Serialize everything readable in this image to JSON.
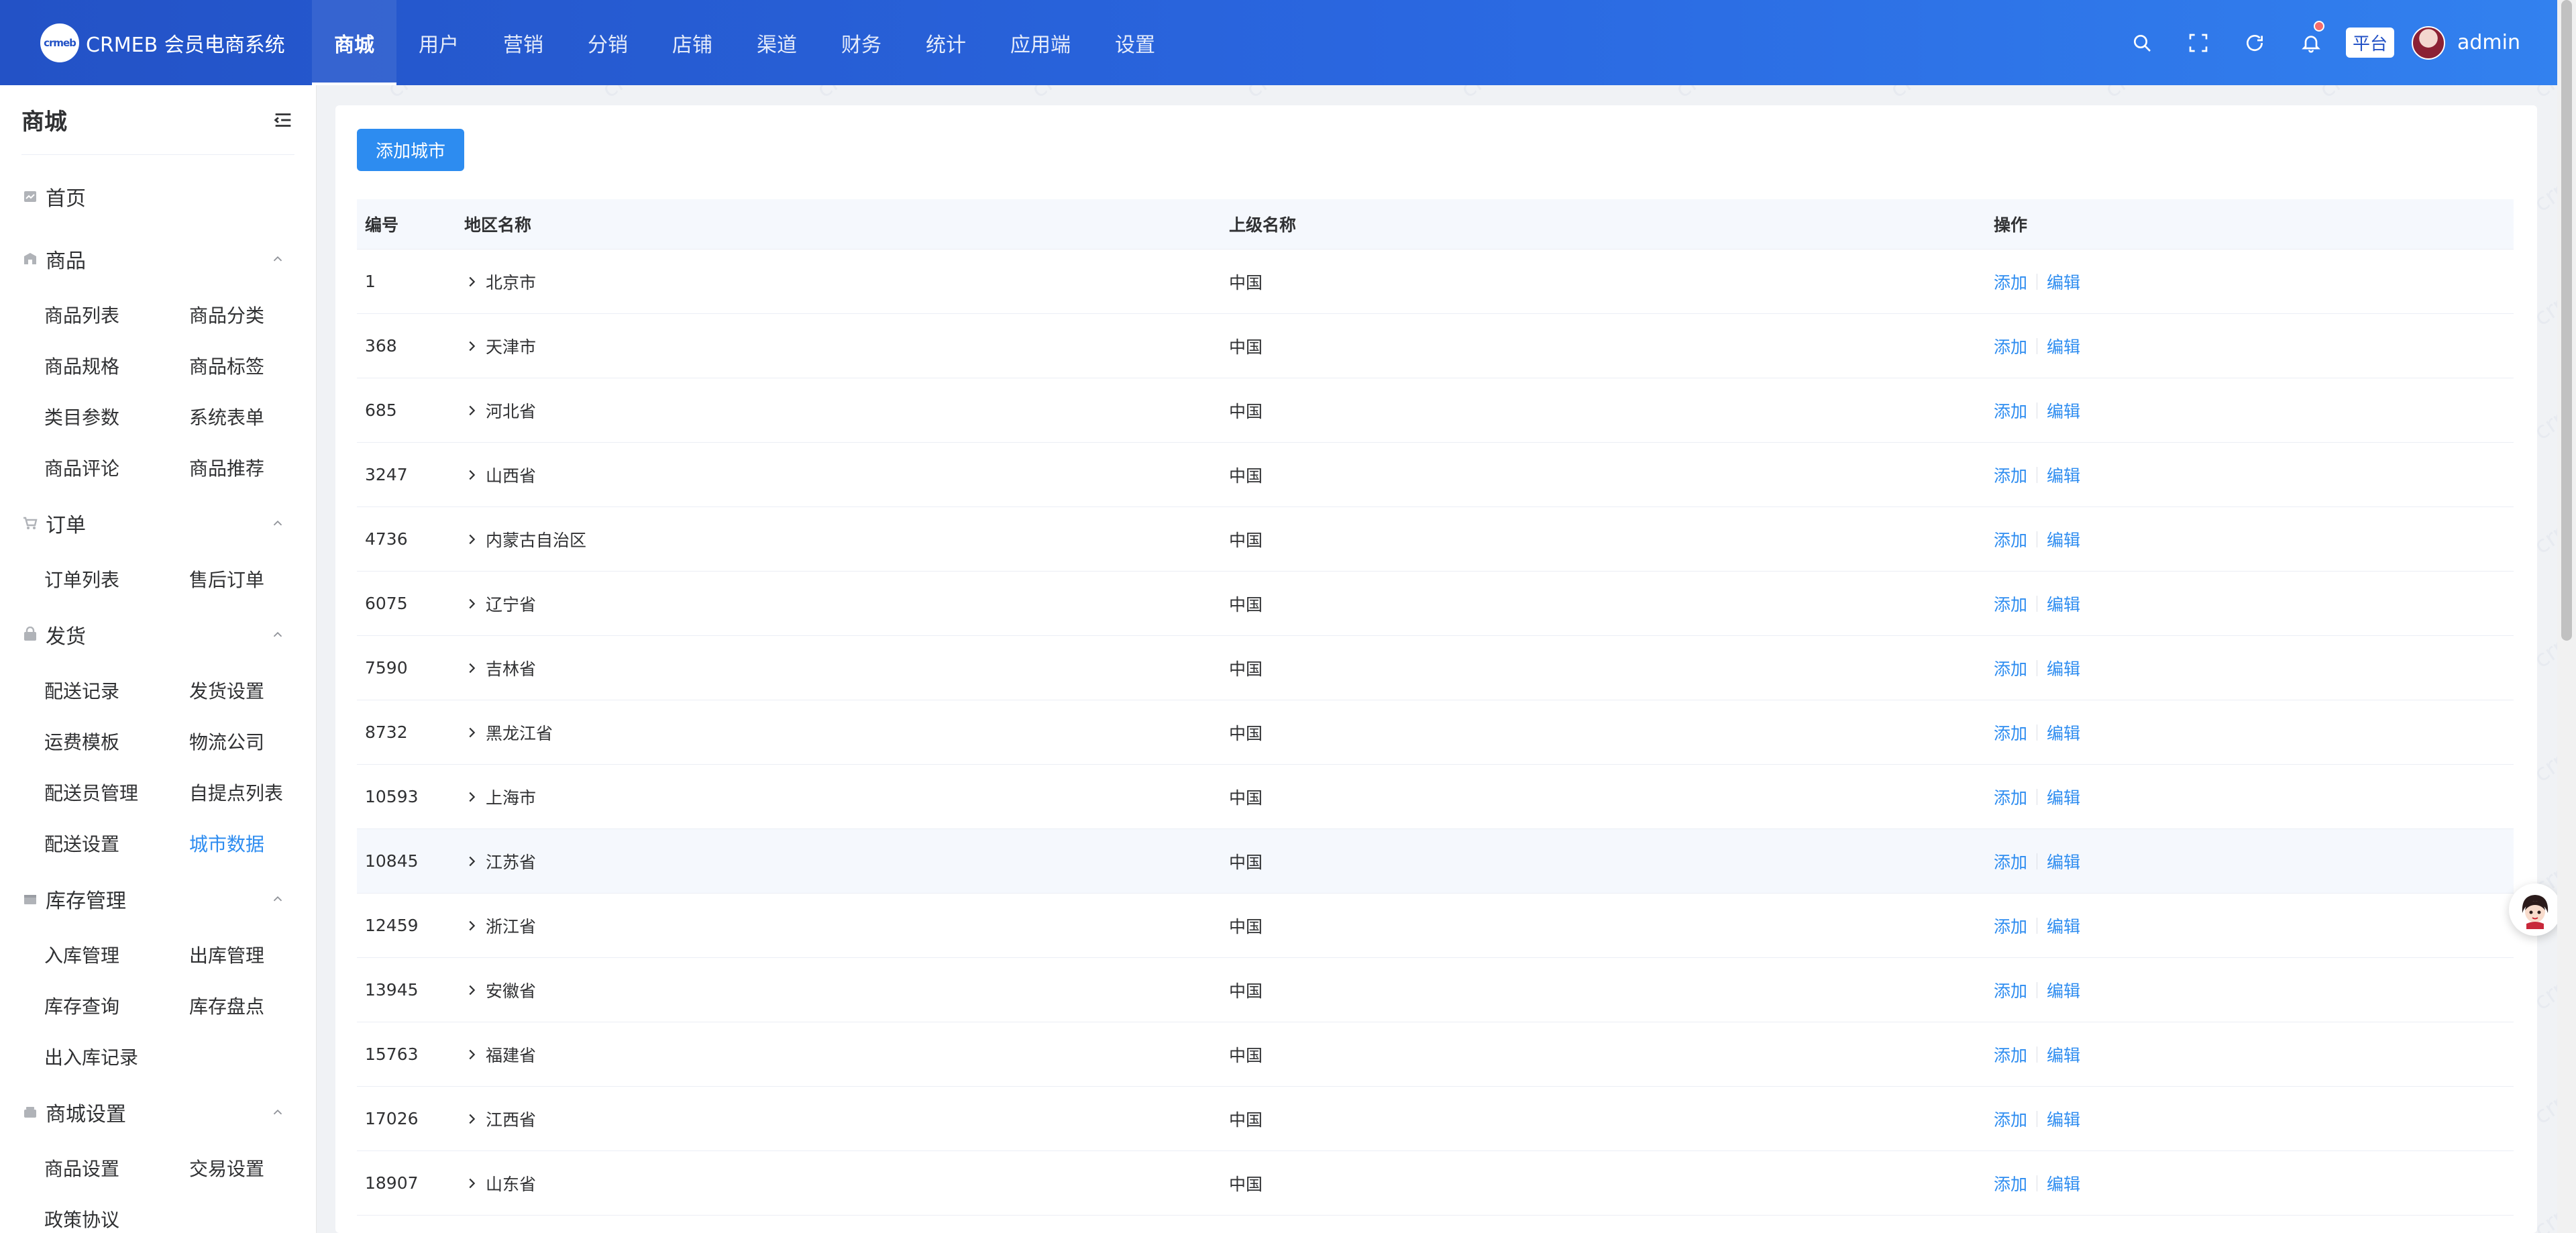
{
  "header": {
    "logo_text": "CRMEB 会员电商系统",
    "logo_mark": "crmeb",
    "nav": [
      {
        "label": "商城",
        "active": true
      },
      {
        "label": "用户"
      },
      {
        "label": "营销"
      },
      {
        "label": "分销"
      },
      {
        "label": "店铺"
      },
      {
        "label": "渠道"
      },
      {
        "label": "财务"
      },
      {
        "label": "统计"
      },
      {
        "label": "应用端"
      },
      {
        "label": "设置"
      }
    ],
    "platform_label": "平台",
    "user_name": "admin"
  },
  "sidebar": {
    "title": "商城",
    "home_label": "首页",
    "groups": [
      {
        "label": "商品",
        "items": [
          "商品列表",
          "商品分类",
          "商品规格",
          "商品标签",
          "类目参数",
          "系统表单",
          "商品评论",
          "商品推荐"
        ]
      },
      {
        "label": "订单",
        "items": [
          "订单列表",
          "售后订单"
        ]
      },
      {
        "label": "发货",
        "items": [
          "配送记录",
          "发货设置",
          "运费模板",
          "物流公司",
          "配送员管理",
          "自提点列表",
          "配送设置",
          "城市数据"
        ],
        "active_item": "城市数据"
      },
      {
        "label": "库存管理",
        "items": [
          "入库管理",
          "出库管理",
          "库存查询",
          "库存盘点",
          "出入库记录"
        ]
      },
      {
        "label": "商城设置",
        "items": [
          "商品设置",
          "交易设置",
          "政策协议"
        ]
      }
    ]
  },
  "main": {
    "add_button_label": "添加城市",
    "columns": {
      "id": "编号",
      "name": "地区名称",
      "parent": "上级名称",
      "ops": "操作"
    },
    "op_add": "添加",
    "op_edit": "编辑",
    "rows": [
      {
        "id": "1",
        "name": "北京市",
        "parent": "中国"
      },
      {
        "id": "368",
        "name": "天津市",
        "parent": "中国"
      },
      {
        "id": "685",
        "name": "河北省",
        "parent": "中国"
      },
      {
        "id": "3247",
        "name": "山西省",
        "parent": "中国"
      },
      {
        "id": "4736",
        "name": "内蒙古自治区",
        "parent": "中国"
      },
      {
        "id": "6075",
        "name": "辽宁省",
        "parent": "中国"
      },
      {
        "id": "7590",
        "name": "吉林省",
        "parent": "中国"
      },
      {
        "id": "8732",
        "name": "黑龙江省",
        "parent": "中国"
      },
      {
        "id": "10593",
        "name": "上海市",
        "parent": "中国"
      },
      {
        "id": "10845",
        "name": "江苏省",
        "parent": "中国",
        "hover": true
      },
      {
        "id": "12459",
        "name": "浙江省",
        "parent": "中国"
      },
      {
        "id": "13945",
        "name": "安徽省",
        "parent": "中国"
      },
      {
        "id": "15763",
        "name": "福建省",
        "parent": "中国"
      },
      {
        "id": "17026",
        "name": "江西省",
        "parent": "中国"
      },
      {
        "id": "18907",
        "name": "山东省",
        "parent": "中国"
      }
    ]
  },
  "watermark_text": "crmeb",
  "colors": {
    "header_start": "#2352c6",
    "header_end": "#3281ef",
    "primary": "#2d8cf0",
    "notice_dot": "#f56c6c"
  }
}
